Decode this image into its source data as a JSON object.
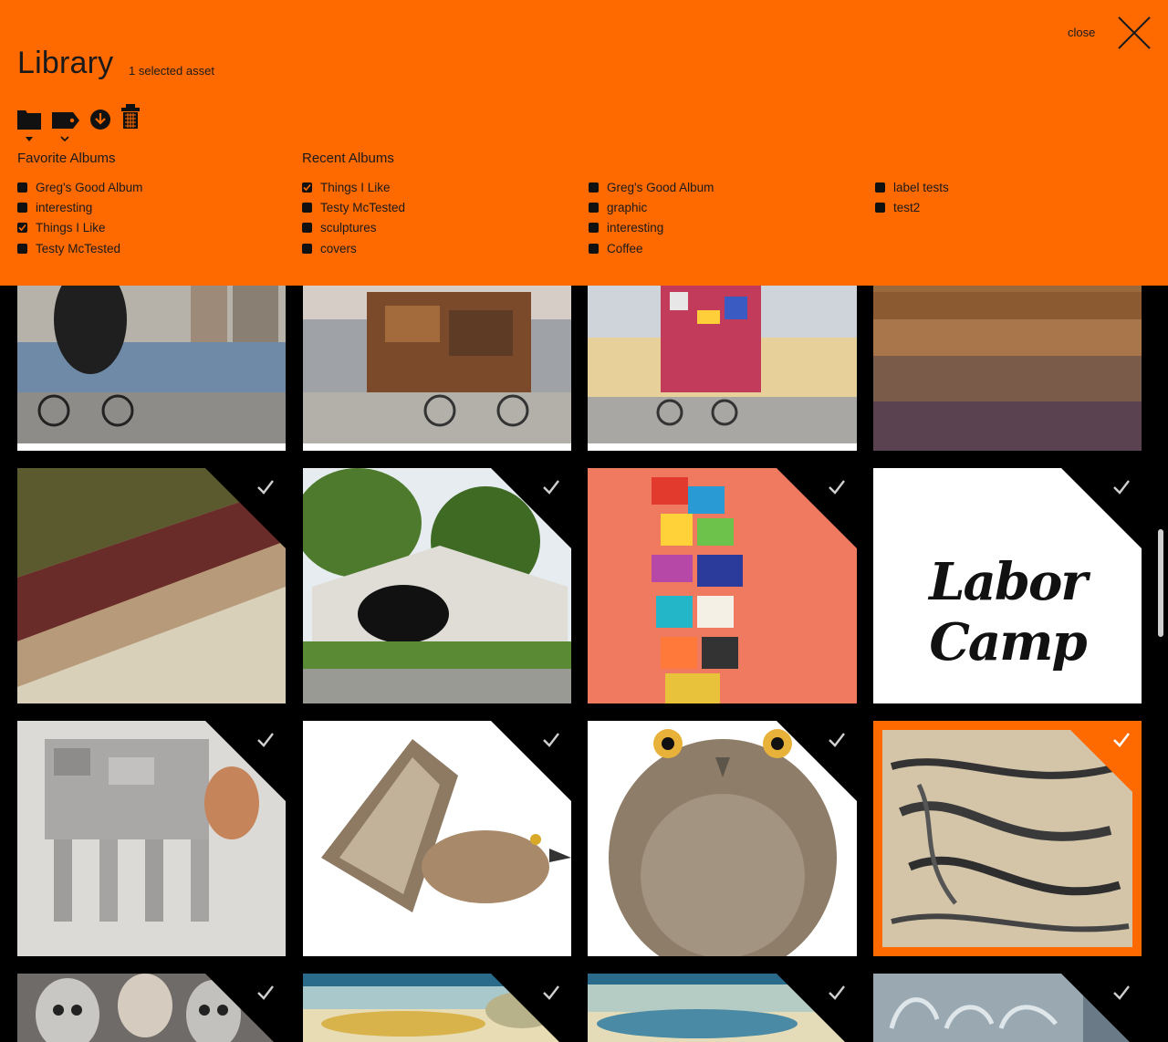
{
  "header": {
    "title": "Library",
    "selection": "1 selected asset",
    "close_label": "close"
  },
  "toolbar": {
    "icons": [
      "folder-icon",
      "tag-icon",
      "download-icon",
      "trash-icon"
    ]
  },
  "favorite_albums": {
    "heading": "Favorite Albums",
    "items": [
      {
        "label": "Greg's Good Album",
        "checked": false
      },
      {
        "label": "interesting",
        "checked": false
      },
      {
        "label": "Things I Like",
        "checked": true
      },
      {
        "label": "Testy McTested",
        "checked": false
      }
    ]
  },
  "recent_albums": {
    "heading": "Recent Albums",
    "col1": [
      {
        "label": "Things I Like",
        "checked": true
      },
      {
        "label": "Testy McTested",
        "checked": false
      },
      {
        "label": "sculptures",
        "checked": false
      },
      {
        "label": "covers",
        "checked": false
      }
    ],
    "col2": [
      {
        "label": "Greg's Good Album",
        "checked": false
      },
      {
        "label": "graphic",
        "checked": false
      },
      {
        "label": "interesting",
        "checked": false
      },
      {
        "label": "Coffee",
        "checked": false
      }
    ],
    "col3": [
      {
        "label": "label tests",
        "checked": false
      },
      {
        "label": "test2",
        "checked": false
      }
    ]
  },
  "assets": {
    "row1": [
      "tires-tricycle",
      "furniture-cart",
      "crates-tricycle",
      "field-stripes"
    ],
    "row2": [
      "aerial-fields",
      "house-hole",
      "colorful-painting",
      "labor-camp-logo"
    ],
    "row3": [
      "dog-walker-costume",
      "hawk-illustration",
      "owl-frogmouth",
      "aerial-racetrack"
    ],
    "row4": [
      "skull-figures",
      "vintage-illustration-a",
      "vintage-illustration-b",
      "drogueria-sign"
    ],
    "labor_camp_text": "Labor Camp",
    "selected_asset": "aerial-racetrack"
  },
  "colors": {
    "accent": "#ff6a00",
    "background": "#000000"
  }
}
